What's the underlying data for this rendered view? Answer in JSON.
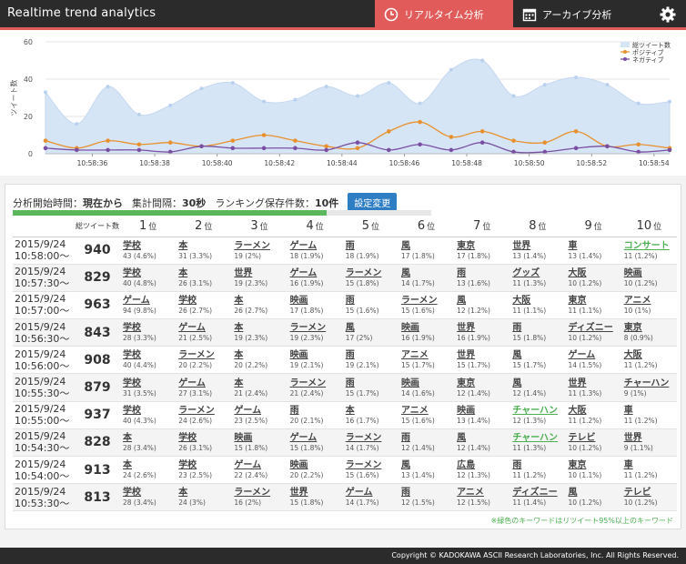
{
  "header": {
    "title": "Realtime trend analytics",
    "tab_realtime": "リアルタイム分析",
    "tab_archive": "アーカイブ分析"
  },
  "chart_data": {
    "type": "line",
    "ylabel": "ツイート数",
    "ylim": [
      0,
      60
    ],
    "yticks": [
      0,
      20,
      40,
      60
    ],
    "xtick_labels": [
      "10:58:36",
      "10:58:38",
      "10:58:40",
      "10:58:42",
      "10:58:44",
      "10:58:46",
      "10:58:48",
      "10:58:50",
      "10:58:52",
      "10:58:54"
    ],
    "xtick_positions": [
      1.5,
      3.5,
      5.5,
      7.5,
      9.5,
      11.5,
      13.5,
      15.5,
      17.5,
      19.5
    ],
    "xlim": [
      0,
      20
    ],
    "legend_position": "top-right",
    "series": [
      {
        "name": "総ツイート数",
        "color": "#d6e5f6",
        "kind": "area",
        "values": [
          33,
          16,
          36,
          21,
          26,
          35,
          38,
          28,
          29,
          36,
          31,
          38,
          27,
          45,
          50,
          31,
          37,
          41,
          37,
          27,
          28
        ]
      },
      {
        "name": "ポジティブ",
        "color": "#e8902e",
        "kind": "line",
        "values": [
          7,
          3,
          7,
          5,
          6,
          4,
          7,
          10,
          7,
          4,
          3,
          12,
          17,
          9,
          12,
          7,
          6,
          12,
          4,
          5,
          3
        ]
      },
      {
        "name": "ネガティブ",
        "color": "#7a4fa3",
        "kind": "line",
        "values": [
          3,
          2,
          2,
          2,
          1,
          4,
          3,
          3,
          3,
          2,
          6,
          2,
          5,
          2,
          6,
          1,
          1,
          3,
          4,
          1,
          2
        ]
      }
    ]
  },
  "controls": {
    "start_label": "分析開始時間：",
    "start_value": "現在から",
    "interval_label": "集計間隔：",
    "interval_value": "30秒",
    "save_label": "ランキング保存件数：",
    "save_value": "10件",
    "settings_button": "設定変更",
    "progress": 0.75
  },
  "table": {
    "total_header": "総ツイート数",
    "rank_suffix": "位",
    "ranks": [
      "1",
      "2",
      "3",
      "4",
      "5",
      "6",
      "7",
      "8",
      "9",
      "10"
    ],
    "rows": [
      {
        "date": "2015/9/24",
        "time": "10:58:00〜",
        "total": "940",
        "kws": [
          {
            "w": "学校",
            "s": "43 (4.6%)"
          },
          {
            "w": "本",
            "s": "31 (3.3%)"
          },
          {
            "w": "ラーメン",
            "s": "19 (2%)"
          },
          {
            "w": "ゲーム",
            "s": "18 (1.9%)"
          },
          {
            "w": "雨",
            "s": "18 (1.9%)"
          },
          {
            "w": "風",
            "s": "17 (1.8%)"
          },
          {
            "w": "東京",
            "s": "17 (1.8%)"
          },
          {
            "w": "世界",
            "s": "13 (1.4%)"
          },
          {
            "w": "車",
            "s": "13 (1.4%)"
          },
          {
            "w": "コンサート",
            "s": "11 (1.2%)",
            "g": true
          }
        ]
      },
      {
        "date": "2015/9/24",
        "time": "10:57:30〜",
        "total": "829",
        "kws": [
          {
            "w": "学校",
            "s": "40 (4.8%)"
          },
          {
            "w": "本",
            "s": "26 (3.1%)"
          },
          {
            "w": "世界",
            "s": "19 (2.3%)"
          },
          {
            "w": "ゲーム",
            "s": "16 (1.9%)"
          },
          {
            "w": "ラーメン",
            "s": "15 (1.8%)"
          },
          {
            "w": "風",
            "s": "14 (1.7%)"
          },
          {
            "w": "雨",
            "s": "13 (1.6%)"
          },
          {
            "w": "グッズ",
            "s": "11 (1.3%)"
          },
          {
            "w": "大阪",
            "s": "10 (1.2%)"
          },
          {
            "w": "映画",
            "s": "10 (1.2%)"
          }
        ]
      },
      {
        "date": "2015/9/24",
        "time": "10:57:00〜",
        "total": "963",
        "kws": [
          {
            "w": "ゲーム",
            "s": "94 (9.8%)"
          },
          {
            "w": "学校",
            "s": "26 (2.7%)"
          },
          {
            "w": "本",
            "s": "26 (2.7%)"
          },
          {
            "w": "映画",
            "s": "17 (1.8%)"
          },
          {
            "w": "雨",
            "s": "15 (1.6%)"
          },
          {
            "w": "ラーメン",
            "s": "15 (1.6%)"
          },
          {
            "w": "風",
            "s": "12 (1.2%)"
          },
          {
            "w": "大阪",
            "s": "11 (1.1%)"
          },
          {
            "w": "東京",
            "s": "11 (1.1%)"
          },
          {
            "w": "アニメ",
            "s": "10 (1%)"
          }
        ]
      },
      {
        "date": "2015/9/24",
        "time": "10:56:30〜",
        "total": "843",
        "kws": [
          {
            "w": "学校",
            "s": "28 (3.3%)"
          },
          {
            "w": "ゲーム",
            "s": "21 (2.5%)"
          },
          {
            "w": "本",
            "s": "19 (2.3%)"
          },
          {
            "w": "ラーメン",
            "s": "19 (2.3%)"
          },
          {
            "w": "風",
            "s": "17 (2%)"
          },
          {
            "w": "映画",
            "s": "16 (1.9%)"
          },
          {
            "w": "世界",
            "s": "16 (1.9%)"
          },
          {
            "w": "雨",
            "s": "15 (1.8%)"
          },
          {
            "w": "ディズニー",
            "s": "10 (1.2%)"
          },
          {
            "w": "東京",
            "s": "8 (0.9%)"
          }
        ]
      },
      {
        "date": "2015/9/24",
        "time": "10:56:00〜",
        "total": "908",
        "kws": [
          {
            "w": "学校",
            "s": "40 (4.4%)"
          },
          {
            "w": "ラーメン",
            "s": "20 (2.2%)"
          },
          {
            "w": "本",
            "s": "20 (2.2%)"
          },
          {
            "w": "映画",
            "s": "19 (2.1%)"
          },
          {
            "w": "雨",
            "s": "19 (2.1%)"
          },
          {
            "w": "アニメ",
            "s": "15 (1.7%)"
          },
          {
            "w": "世界",
            "s": "15 (1.7%)"
          },
          {
            "w": "風",
            "s": "15 (1.7%)"
          },
          {
            "w": "ゲーム",
            "s": "14 (1.5%)"
          },
          {
            "w": "大阪",
            "s": "11 (1.2%)"
          }
        ]
      },
      {
        "date": "2015/9/24",
        "time": "10:55:30〜",
        "total": "879",
        "kws": [
          {
            "w": "学校",
            "s": "31 (3.5%)"
          },
          {
            "w": "ゲーム",
            "s": "27 (3.1%)"
          },
          {
            "w": "本",
            "s": "21 (2.4%)"
          },
          {
            "w": "ラーメン",
            "s": "21 (2.4%)"
          },
          {
            "w": "雨",
            "s": "15 (1.7%)"
          },
          {
            "w": "映画",
            "s": "14 (1.6%)"
          },
          {
            "w": "東京",
            "s": "12 (1.4%)"
          },
          {
            "w": "風",
            "s": "12 (1.4%)"
          },
          {
            "w": "世界",
            "s": "11 (1.3%)"
          },
          {
            "w": "チャーハン",
            "s": "9 (1%)"
          }
        ]
      },
      {
        "date": "2015/9/24",
        "time": "10:55:00〜",
        "total": "937",
        "kws": [
          {
            "w": "学校",
            "s": "40 (4.3%)"
          },
          {
            "w": "ラーメン",
            "s": "24 (2.6%)"
          },
          {
            "w": "ゲーム",
            "s": "23 (2.5%)"
          },
          {
            "w": "雨",
            "s": "20 (2.1%)"
          },
          {
            "w": "本",
            "s": "16 (1.7%)"
          },
          {
            "w": "アニメ",
            "s": "15 (1.6%)"
          },
          {
            "w": "映画",
            "s": "13 (1.4%)"
          },
          {
            "w": "チャーハン",
            "s": "12 (1.3%)",
            "g": true
          },
          {
            "w": "大阪",
            "s": "11 (1.2%)"
          },
          {
            "w": "車",
            "s": "11 (1.2%)"
          }
        ]
      },
      {
        "date": "2015/9/24",
        "time": "10:54:30〜",
        "total": "828",
        "kws": [
          {
            "w": "本",
            "s": "28 (3.4%)"
          },
          {
            "w": "学校",
            "s": "26 (3.1%)"
          },
          {
            "w": "映画",
            "s": "15 (1.8%)"
          },
          {
            "w": "ゲーム",
            "s": "15 (1.8%)"
          },
          {
            "w": "ラーメン",
            "s": "14 (1.7%)"
          },
          {
            "w": "雨",
            "s": "12 (1.4%)"
          },
          {
            "w": "風",
            "s": "12 (1.4%)"
          },
          {
            "w": "チャーハン",
            "s": "11 (1.3%)",
            "g": true
          },
          {
            "w": "テレビ",
            "s": "10 (1.2%)"
          },
          {
            "w": "世界",
            "s": "9 (1.1%)"
          }
        ]
      },
      {
        "date": "2015/9/24",
        "time": "10:54:00〜",
        "total": "913",
        "kws": [
          {
            "w": "本",
            "s": "24 (2.6%)"
          },
          {
            "w": "学校",
            "s": "23 (2.5%)"
          },
          {
            "w": "ゲーム",
            "s": "22 (2.4%)"
          },
          {
            "w": "映画",
            "s": "20 (2.2%)"
          },
          {
            "w": "ラーメン",
            "s": "15 (1.6%)"
          },
          {
            "w": "風",
            "s": "13 (1.4%)"
          },
          {
            "w": "広島",
            "s": "12 (1.3%)"
          },
          {
            "w": "雨",
            "s": "11 (1.2%)"
          },
          {
            "w": "東京",
            "s": "10 (1.1%)"
          },
          {
            "w": "車",
            "s": "11 (1.2%)"
          }
        ]
      },
      {
        "date": "2015/9/24",
        "time": "10:53:30〜",
        "total": "813",
        "kws": [
          {
            "w": "学校",
            "s": "28 (3.4%)"
          },
          {
            "w": "本",
            "s": "24 (3%)"
          },
          {
            "w": "ラーメン",
            "s": "16 (2%)"
          },
          {
            "w": "世界",
            "s": "15 (1.8%)"
          },
          {
            "w": "ゲーム",
            "s": "14 (1.7%)"
          },
          {
            "w": "雨",
            "s": "12 (1.5%)"
          },
          {
            "w": "アニメ",
            "s": "12 (1.5%)"
          },
          {
            "w": "ディズニー",
            "s": "11 (1.4%)"
          },
          {
            "w": "風",
            "s": "10 (1.2%)"
          },
          {
            "w": "テレビ",
            "s": "10 (1.2%)"
          }
        ]
      }
    ]
  },
  "legend_note": "※緑色のキーワードはリツイート95%以上のキーワード",
  "footer": "Copyright © KADOKAWA ASCII Research Laboratories, Inc. All Rights Reserved."
}
